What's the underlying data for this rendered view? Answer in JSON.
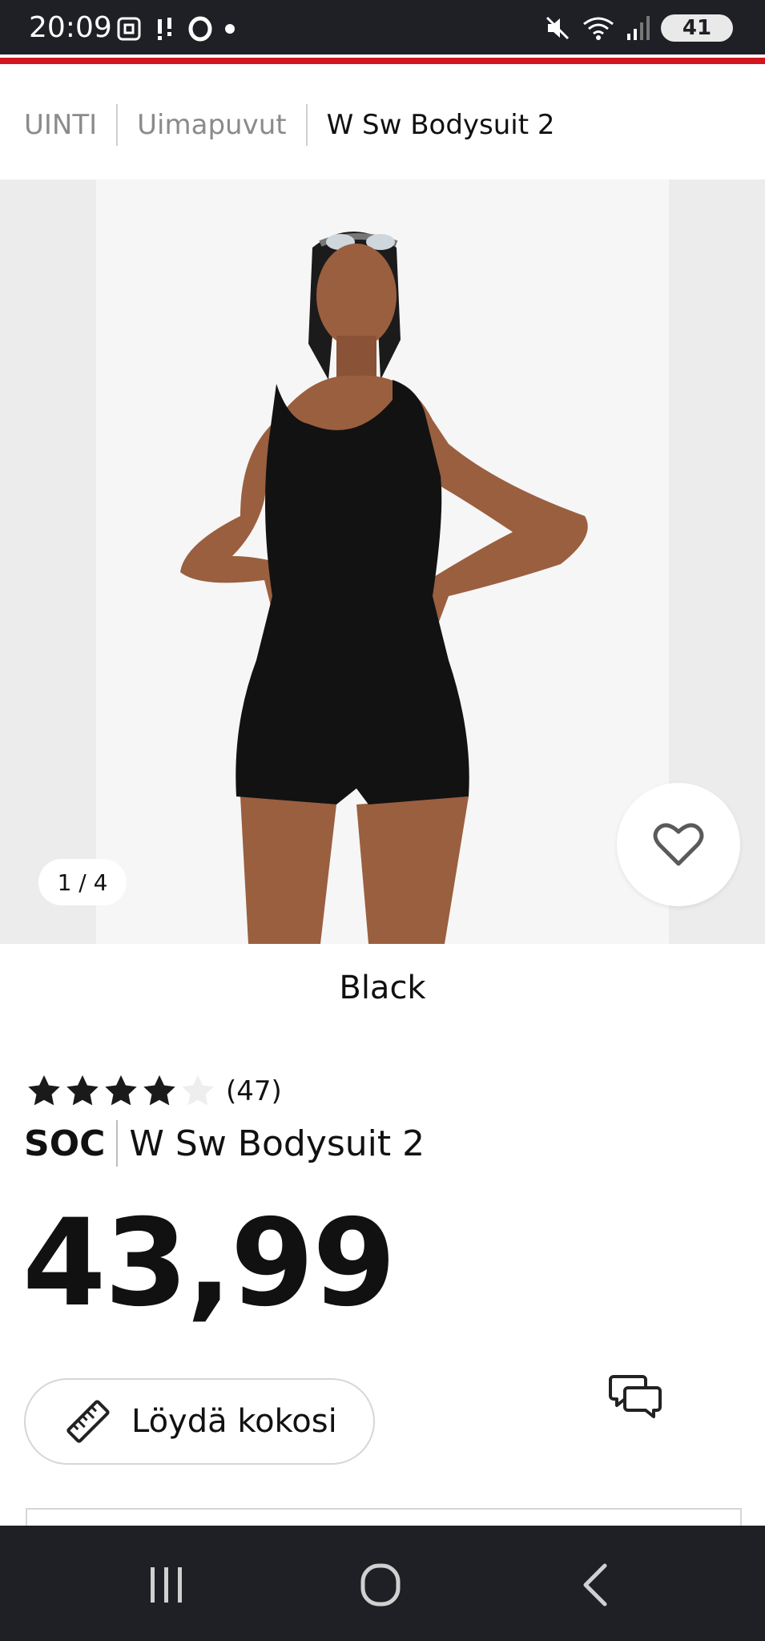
{
  "status_bar": {
    "time": "20:09",
    "battery": "41",
    "left_icons": [
      "screenshot-icon",
      "notification-icon",
      "opera-icon",
      "dot-icon"
    ],
    "right_icons": [
      "mute-icon",
      "wifi-icon",
      "signal-icon",
      "battery-icon"
    ]
  },
  "accent_color": "#d1161f",
  "breadcrumb": [
    "UINTI",
    "Uimapuvut",
    "W Sw Bodysuit 2"
  ],
  "gallery": {
    "counter": "1 / 4"
  },
  "product": {
    "color": "Black",
    "rating": 4,
    "rating_max": 5,
    "review_count": "(47)",
    "brand": "SOC",
    "name": "W Sw Bodysuit 2",
    "price": "43,99"
  },
  "actions": {
    "size_label": "Löydä kokosi",
    "size_icon": "ruler-icon",
    "chat_icon": "chat-icon",
    "favorite_icon": "heart-icon"
  },
  "nav_bar": [
    "recents-icon",
    "home-icon",
    "back-icon"
  ]
}
